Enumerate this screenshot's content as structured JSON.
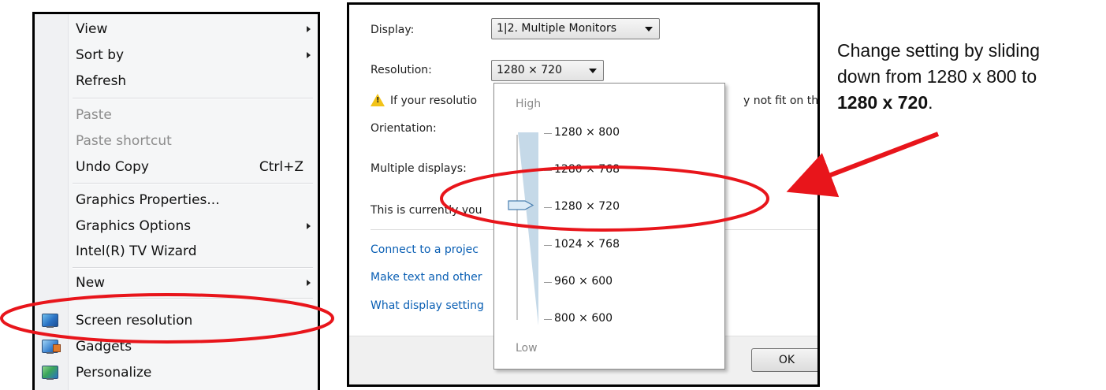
{
  "context_menu": {
    "items": [
      {
        "label": "View",
        "submenu": true
      },
      {
        "label": "Sort by",
        "submenu": true
      },
      {
        "label": "Refresh"
      },
      {
        "label": "Paste",
        "disabled": true
      },
      {
        "label": "Paste shortcut",
        "disabled": true
      },
      {
        "label": "Undo Copy",
        "shortcut": "Ctrl+Z"
      },
      {
        "label": "Graphics Properties..."
      },
      {
        "label": "Graphics Options",
        "submenu": true
      },
      {
        "label": "Intel(R) TV Wizard"
      },
      {
        "label": "New",
        "submenu": true
      },
      {
        "label": "Screen resolution",
        "icon": "monitor-icon"
      },
      {
        "label": "Gadgets",
        "icon": "gadgets-icon"
      },
      {
        "label": "Personalize",
        "icon": "personalize-icon"
      }
    ]
  },
  "dialog": {
    "display_label": "Display:",
    "display_value": "1|2. Multiple Monitors",
    "resolution_label": "Resolution:",
    "resolution_value": "1280 × 720",
    "warning_start": "If your resolutio",
    "warning_end": "y not fit on the",
    "orientation_label": "Orientation:",
    "multiple_displays_label": "Multiple displays:",
    "currently_text": "This is currently you",
    "link_project": "Connect to a projec",
    "link_text": "Make text and other",
    "link_settings": "What display setting",
    "ok_label": "OK"
  },
  "resolution_dropdown": {
    "high_label": "High",
    "low_label": "Low",
    "options": [
      "1280 × 800",
      "1280 × 768",
      "1280 × 720",
      "1024 × 768",
      "960 × 600",
      "800 × 600"
    ],
    "selected": "1280 × 720"
  },
  "annotation": {
    "text_line1": "Change setting by sliding",
    "text_line2": "down from 1280 x 800 to",
    "text_bold": "1280 x 720",
    "text_end": ".",
    "highlight_color": "#e8151b"
  }
}
